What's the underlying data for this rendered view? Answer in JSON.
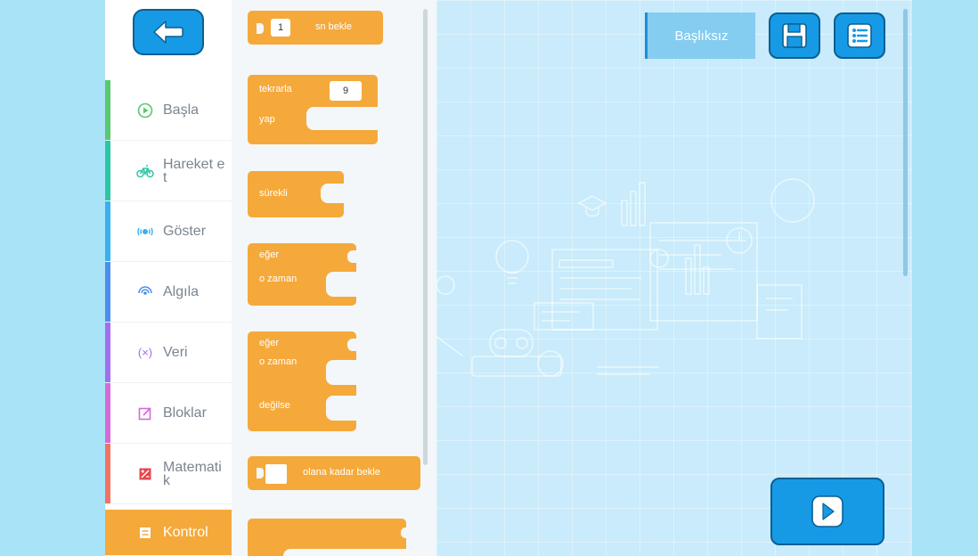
{
  "header": {
    "project_title": "Başlıksız"
  },
  "icons": {
    "back": "arrow-left-icon",
    "save": "save-icon",
    "menu": "list-icon",
    "play": "play-icon"
  },
  "sidebar": {
    "items": [
      {
        "label": "Başla",
        "icon": "play-circle-icon",
        "color": "#5cc870"
      },
      {
        "label": "Hareket et",
        "icon": "bike-icon",
        "color": "#2ac7a6"
      },
      {
        "label": "Göster",
        "icon": "light-icon",
        "color": "#3ab0ee"
      },
      {
        "label": "Algıla",
        "icon": "sensor-icon",
        "color": "#4b8ff0"
      },
      {
        "label": "Veri",
        "icon": "variable-icon",
        "color": "#a26ef2"
      },
      {
        "label": "Bloklar",
        "icon": "edit-icon",
        "color": "#d56ad8"
      },
      {
        "label": "Matematik",
        "icon": "math-icon",
        "color": "#f07365"
      },
      {
        "label": "Kontrol",
        "icon": "control-icon",
        "color": "#f5a93a"
      }
    ]
  },
  "blocks": {
    "wait_value": "1",
    "wait_label": "sn bekle",
    "repeat_label": "tekrarla",
    "repeat_value": "9",
    "repeat_do": "yap",
    "forever": "sürekli",
    "if_label": "eğer",
    "then_label": "o zaman",
    "ifelse_if": "eğer",
    "ifelse_then": "o zaman",
    "ifelse_else": "değilse",
    "wait_until": "olana kadar bekle"
  },
  "colors": {
    "accent": "#179ae6",
    "control": "#f5a93a",
    "background": "#a9e3f7"
  }
}
